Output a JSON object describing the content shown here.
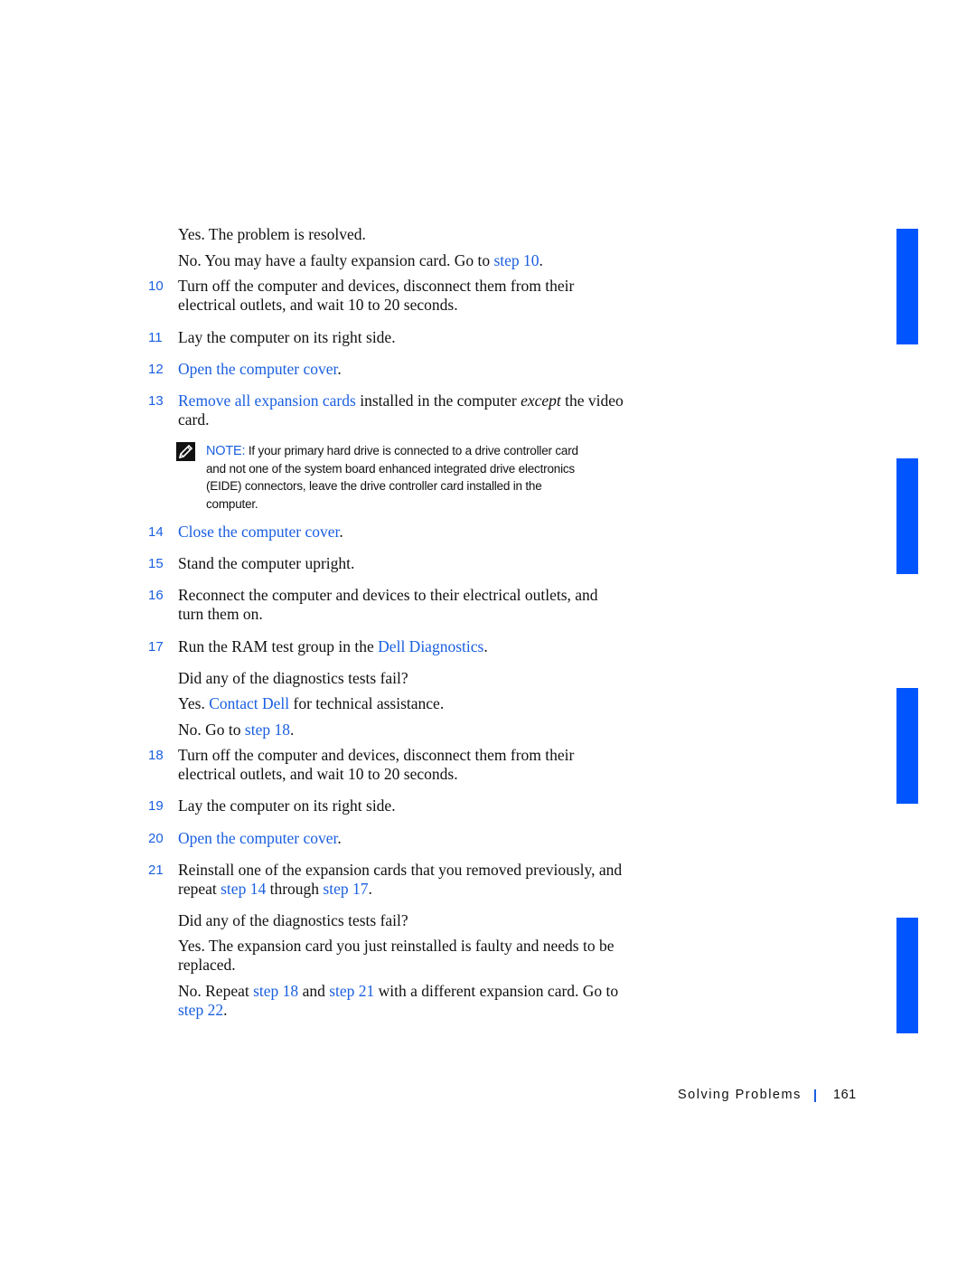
{
  "colors": {
    "accent": "#1a5fe0",
    "tab": "#0055ff",
    "text": "#111111"
  },
  "content": {
    "l1": "Yes. The problem is resolved.",
    "l2": {
      "pre": "No. You may have a faulty expansion card. Go to ",
      "link": "step 10",
      "post": "."
    },
    "s10": {
      "num": "10",
      "line1": "Turn off the computer and devices, disconnect them from their",
      "line2": "electrical outlets, and wait 10 to 20 seconds."
    },
    "s11": {
      "num": "11",
      "text": "Lay the computer on its right side."
    },
    "s12": {
      "num": "12",
      "link": "Open the computer cover",
      "post": "."
    },
    "s13": {
      "num": "13",
      "link": "Remove all expansion cards",
      "mid": " installed in the computer ",
      "em": "except",
      "post": " the video",
      "line2": "card."
    },
    "note": {
      "icon": "note-pencil-icon",
      "label": "NOTE:",
      "line1": " If your primary hard drive is connected to a drive controller card",
      "line2": "and not one of the system board enhanced integrated drive electronics",
      "line3": "(EIDE) connectors, leave the drive controller card installed in the",
      "line4": "computer."
    },
    "s14": {
      "num": "14",
      "link": "Close the computer cover",
      "post": "."
    },
    "s15": {
      "num": "15",
      "text": "Stand the computer upright."
    },
    "s16": {
      "num": "16",
      "line1": "Reconnect the computer and devices to their electrical outlets, and",
      "line2": "turn them on."
    },
    "s17": {
      "num": "17",
      "pre": "Run the RAM test group in the ",
      "link": "Dell Diagnostics",
      "post": "."
    },
    "q1": "Did any of the diagnostics tests fail?",
    "q1yes": {
      "pre": "Yes. ",
      "link": "Contact Dell",
      "post": " for technical assistance."
    },
    "q1no": {
      "pre": "No. Go to ",
      "link": "step 18",
      "post": "."
    },
    "s18": {
      "num": "18",
      "line1": "Turn off the computer and devices, disconnect them from their",
      "line2": "electrical outlets, and wait 10 to 20 seconds."
    },
    "s19": {
      "num": "19",
      "text": "Lay the computer on its right side."
    },
    "s20": {
      "num": "20",
      "link": "Open the computer cover",
      "post": "."
    },
    "s21": {
      "num": "21",
      "line1": "Reinstall one of the expansion cards that you removed previously, and",
      "pre2": "repeat ",
      "link1": "step 14",
      "mid2": " through ",
      "link2": "step 17",
      "post2": "."
    },
    "q2": "Did any of the diagnostics tests fail?",
    "q2yes": {
      "line1": "Yes. The expansion card you just reinstalled is faulty and needs to be",
      "line2": "replaced."
    },
    "q2no": {
      "pre": "No. Repeat ",
      "link1": "step 18",
      "mid": " and ",
      "link2": "step 21",
      "post": " with a different expansion card. Go to",
      "link3": "step 22",
      "post3": "."
    }
  },
  "footer": {
    "section": "Solving Problems",
    "page": "161"
  }
}
